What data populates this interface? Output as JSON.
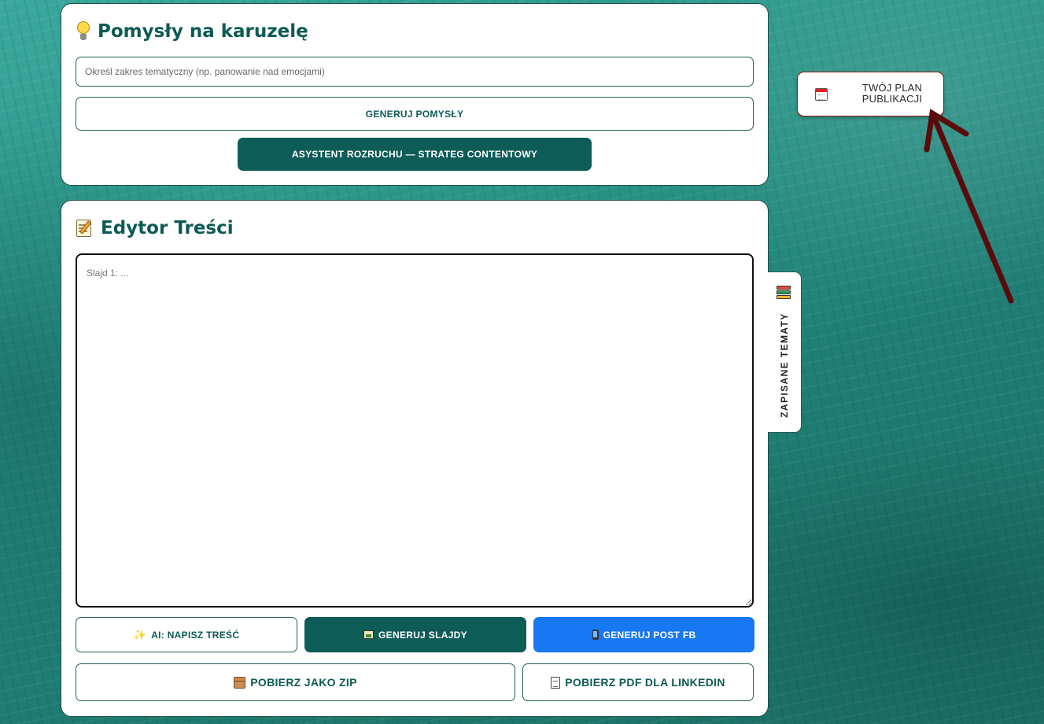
{
  "ideas": {
    "title": "Pomysły na karuzelę",
    "icon": "lightbulb-icon",
    "topic_input": {
      "placeholder": "Określ zakres tematyczny (np. panowanie nad emocjami)",
      "value": ""
    },
    "generate_label": "GENERUJ POMYSŁY",
    "assistant_label": "ASYSTENT ROZRUCHU — STRATEG CONTENTOWY"
  },
  "editor": {
    "title": "Edytor Treści",
    "icon": "memo-icon",
    "textarea": {
      "placeholder": "Slajd 1: ...",
      "value": ""
    },
    "actions": {
      "ai_write": {
        "label": "AI: NAPISZ TREŚĆ",
        "icon": "sparkles-icon"
      },
      "generate_slides": {
        "label": "GENERUJ SLAJDY",
        "icon": "picture-icon"
      },
      "generate_fb": {
        "label": "GENERUJ POST FB",
        "icon": "phone-icon"
      },
      "download_zip": {
        "label": "POBIERZ JAKO ZIP",
        "icon": "package-icon"
      },
      "download_pdf": {
        "label": "POBIERZ PDF DLA LINKEDIN",
        "icon": "page-icon"
      }
    }
  },
  "side_tab": {
    "label": "ZAPISANE TEMATY",
    "icon": "books-icon"
  },
  "plan_button": {
    "line1": "TWÓJ PLAN",
    "line2": "PUBLIKACJI",
    "icon": "calendar-icon"
  },
  "colors": {
    "primary": "#0d5c58",
    "facebook_blue": "#1877f2",
    "plan_border": "#8a1a1a",
    "arrow": "#5a0c0c",
    "background": "#2a9488"
  }
}
